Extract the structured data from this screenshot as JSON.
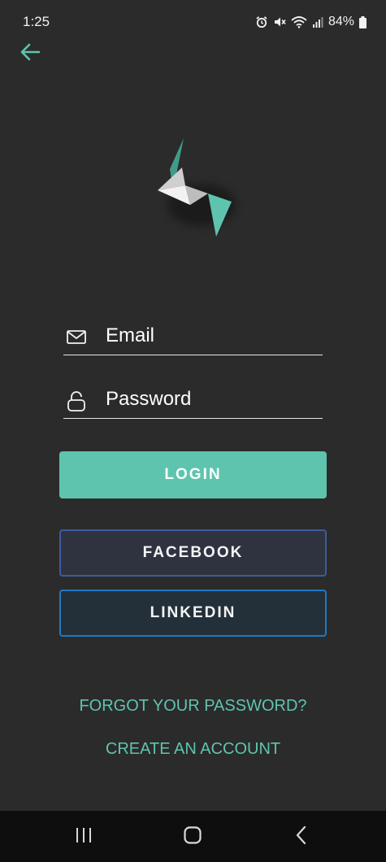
{
  "status_bar": {
    "time": "1:25",
    "battery_percent": "84%",
    "icons": [
      "alarm-icon",
      "mute-icon",
      "wifi-icon",
      "signal-icon",
      "battery-icon"
    ]
  },
  "header": {
    "back_icon": "arrow-left-icon"
  },
  "login_form": {
    "email_placeholder": "Email",
    "password_placeholder": "Password",
    "login_label": "LOGIN",
    "facebook_label": "FACEBOOK",
    "linkedin_label": "LINKEDIN"
  },
  "links": {
    "forgot_password": "FORGOT YOUR PASSWORD?",
    "create_account": "CREATE AN ACCOUNT"
  },
  "colors": {
    "background": "#2b2b2b",
    "accent": "#5fc4ae",
    "facebook_border": "#3d5b9e",
    "linkedin_border": "#1f79c2",
    "nav_bar": "#0e0e0e"
  },
  "nav_bar": {
    "icons": [
      "recents-icon",
      "home-icon",
      "back-icon"
    ]
  }
}
